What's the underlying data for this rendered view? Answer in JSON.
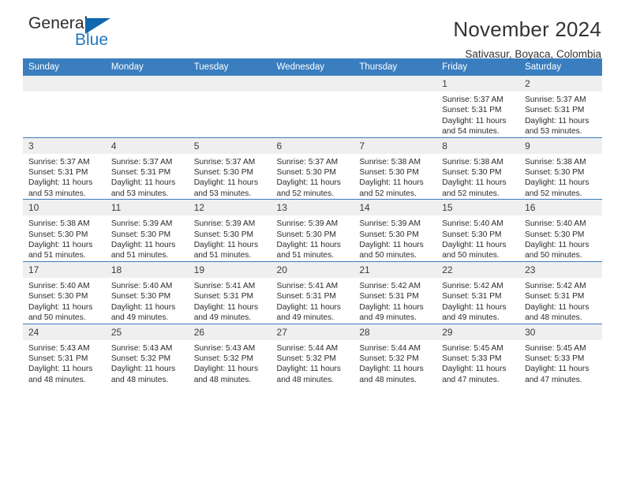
{
  "brand": {
    "name_part1": "General",
    "name_part2": "Blue",
    "logo_icon": "triangle-logo-icon",
    "accent_color": "#1167ae"
  },
  "header": {
    "title": "November 2024",
    "location": "Sativasur, Boyaca, Colombia",
    "header_bg_color": "#3a7ebf",
    "daynum_bg_color": "#efefef"
  },
  "weekday_headers": [
    "Sunday",
    "Monday",
    "Tuesday",
    "Wednesday",
    "Thursday",
    "Friday",
    "Saturday"
  ],
  "weeks": [
    [
      {
        "day": "",
        "empty": true
      },
      {
        "day": "",
        "empty": true
      },
      {
        "day": "",
        "empty": true
      },
      {
        "day": "",
        "empty": true
      },
      {
        "day": "",
        "empty": true
      },
      {
        "day": "1",
        "sunrise": "Sunrise: 5:37 AM",
        "sunset": "Sunset: 5:31 PM",
        "daylight": "Daylight: 11 hours and 54 minutes."
      },
      {
        "day": "2",
        "sunrise": "Sunrise: 5:37 AM",
        "sunset": "Sunset: 5:31 PM",
        "daylight": "Daylight: 11 hours and 53 minutes."
      }
    ],
    [
      {
        "day": "3",
        "sunrise": "Sunrise: 5:37 AM",
        "sunset": "Sunset: 5:31 PM",
        "daylight": "Daylight: 11 hours and 53 minutes."
      },
      {
        "day": "4",
        "sunrise": "Sunrise: 5:37 AM",
        "sunset": "Sunset: 5:31 PM",
        "daylight": "Daylight: 11 hours and 53 minutes."
      },
      {
        "day": "5",
        "sunrise": "Sunrise: 5:37 AM",
        "sunset": "Sunset: 5:30 PM",
        "daylight": "Daylight: 11 hours and 53 minutes."
      },
      {
        "day": "6",
        "sunrise": "Sunrise: 5:37 AM",
        "sunset": "Sunset: 5:30 PM",
        "daylight": "Daylight: 11 hours and 52 minutes."
      },
      {
        "day": "7",
        "sunrise": "Sunrise: 5:38 AM",
        "sunset": "Sunset: 5:30 PM",
        "daylight": "Daylight: 11 hours and 52 minutes."
      },
      {
        "day": "8",
        "sunrise": "Sunrise: 5:38 AM",
        "sunset": "Sunset: 5:30 PM",
        "daylight": "Daylight: 11 hours and 52 minutes."
      },
      {
        "day": "9",
        "sunrise": "Sunrise: 5:38 AM",
        "sunset": "Sunset: 5:30 PM",
        "daylight": "Daylight: 11 hours and 52 minutes."
      }
    ],
    [
      {
        "day": "10",
        "sunrise": "Sunrise: 5:38 AM",
        "sunset": "Sunset: 5:30 PM",
        "daylight": "Daylight: 11 hours and 51 minutes."
      },
      {
        "day": "11",
        "sunrise": "Sunrise: 5:39 AM",
        "sunset": "Sunset: 5:30 PM",
        "daylight": "Daylight: 11 hours and 51 minutes."
      },
      {
        "day": "12",
        "sunrise": "Sunrise: 5:39 AM",
        "sunset": "Sunset: 5:30 PM",
        "daylight": "Daylight: 11 hours and 51 minutes."
      },
      {
        "day": "13",
        "sunrise": "Sunrise: 5:39 AM",
        "sunset": "Sunset: 5:30 PM",
        "daylight": "Daylight: 11 hours and 51 minutes."
      },
      {
        "day": "14",
        "sunrise": "Sunrise: 5:39 AM",
        "sunset": "Sunset: 5:30 PM",
        "daylight": "Daylight: 11 hours and 50 minutes."
      },
      {
        "day": "15",
        "sunrise": "Sunrise: 5:40 AM",
        "sunset": "Sunset: 5:30 PM",
        "daylight": "Daylight: 11 hours and 50 minutes."
      },
      {
        "day": "16",
        "sunrise": "Sunrise: 5:40 AM",
        "sunset": "Sunset: 5:30 PM",
        "daylight": "Daylight: 11 hours and 50 minutes."
      }
    ],
    [
      {
        "day": "17",
        "sunrise": "Sunrise: 5:40 AM",
        "sunset": "Sunset: 5:30 PM",
        "daylight": "Daylight: 11 hours and 50 minutes."
      },
      {
        "day": "18",
        "sunrise": "Sunrise: 5:40 AM",
        "sunset": "Sunset: 5:30 PM",
        "daylight": "Daylight: 11 hours and 49 minutes."
      },
      {
        "day": "19",
        "sunrise": "Sunrise: 5:41 AM",
        "sunset": "Sunset: 5:31 PM",
        "daylight": "Daylight: 11 hours and 49 minutes."
      },
      {
        "day": "20",
        "sunrise": "Sunrise: 5:41 AM",
        "sunset": "Sunset: 5:31 PM",
        "daylight": "Daylight: 11 hours and 49 minutes."
      },
      {
        "day": "21",
        "sunrise": "Sunrise: 5:42 AM",
        "sunset": "Sunset: 5:31 PM",
        "daylight": "Daylight: 11 hours and 49 minutes."
      },
      {
        "day": "22",
        "sunrise": "Sunrise: 5:42 AM",
        "sunset": "Sunset: 5:31 PM",
        "daylight": "Daylight: 11 hours and 49 minutes."
      },
      {
        "day": "23",
        "sunrise": "Sunrise: 5:42 AM",
        "sunset": "Sunset: 5:31 PM",
        "daylight": "Daylight: 11 hours and 48 minutes."
      }
    ],
    [
      {
        "day": "24",
        "sunrise": "Sunrise: 5:43 AM",
        "sunset": "Sunset: 5:31 PM",
        "daylight": "Daylight: 11 hours and 48 minutes."
      },
      {
        "day": "25",
        "sunrise": "Sunrise: 5:43 AM",
        "sunset": "Sunset: 5:32 PM",
        "daylight": "Daylight: 11 hours and 48 minutes."
      },
      {
        "day": "26",
        "sunrise": "Sunrise: 5:43 AM",
        "sunset": "Sunset: 5:32 PM",
        "daylight": "Daylight: 11 hours and 48 minutes."
      },
      {
        "day": "27",
        "sunrise": "Sunrise: 5:44 AM",
        "sunset": "Sunset: 5:32 PM",
        "daylight": "Daylight: 11 hours and 48 minutes."
      },
      {
        "day": "28",
        "sunrise": "Sunrise: 5:44 AM",
        "sunset": "Sunset: 5:32 PM",
        "daylight": "Daylight: 11 hours and 48 minutes."
      },
      {
        "day": "29",
        "sunrise": "Sunrise: 5:45 AM",
        "sunset": "Sunset: 5:33 PM",
        "daylight": "Daylight: 11 hours and 47 minutes."
      },
      {
        "day": "30",
        "sunrise": "Sunrise: 5:45 AM",
        "sunset": "Sunset: 5:33 PM",
        "daylight": "Daylight: 11 hours and 47 minutes."
      }
    ]
  ]
}
